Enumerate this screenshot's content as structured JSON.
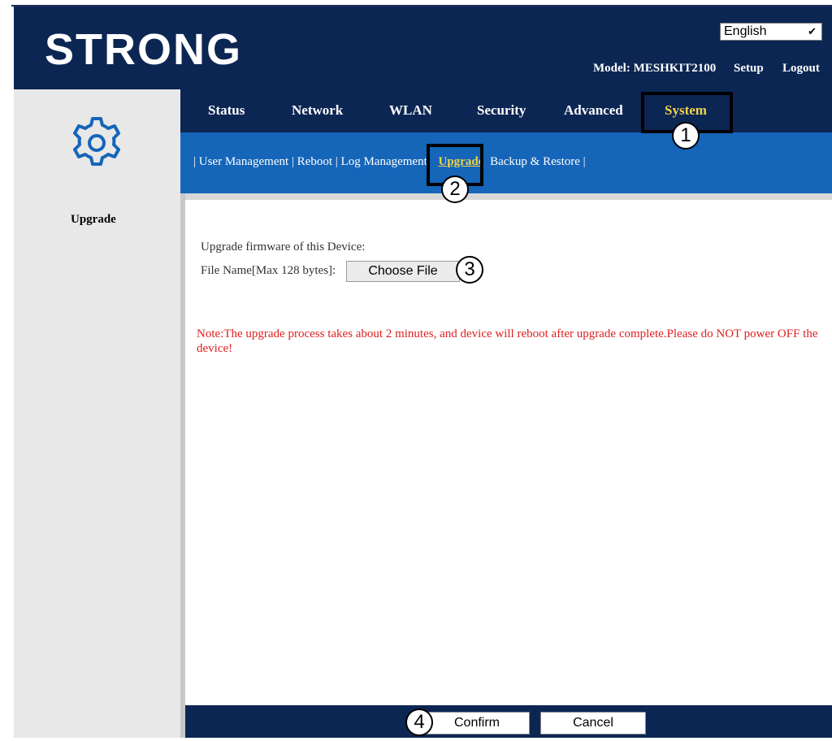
{
  "brand": {
    "logo_text": "STRONG"
  },
  "language_select": {
    "value": "English"
  },
  "header_links": {
    "model": "Model: MESHKIT2100",
    "setup": "Setup",
    "logout": "Logout"
  },
  "nav": {
    "tabs": [
      "Status",
      "Network",
      "WLAN",
      "Security",
      "Advanced",
      "System"
    ],
    "active": "System"
  },
  "subnav": {
    "items": [
      "User Management",
      "Reboot",
      "Log Management",
      "Upgrade",
      "Backup & Restore"
    ],
    "active": "Upgrade",
    "separator": "|"
  },
  "sidebar": {
    "label": "Upgrade"
  },
  "main": {
    "intro": "Upgrade firmware of this Device:",
    "file_label": "File Name[Max 128 bytes]:",
    "choose_file": "Choose File",
    "note": "Note:The upgrade process takes about 2 minutes, and device will reboot after upgrade complete.Please do NOT power OFF the device!"
  },
  "footer": {
    "confirm": "Confirm",
    "cancel": "Cancel"
  },
  "callouts": [
    "1",
    "2",
    "3",
    "4"
  ],
  "colors": {
    "header_bg": "#0c2653",
    "subnav_bg": "#1565b8",
    "active_text": "#f0d34a",
    "note_text": "#e02020"
  },
  "icons": {
    "settings": "gear-icon",
    "dropdown": "chevron-down-icon"
  }
}
